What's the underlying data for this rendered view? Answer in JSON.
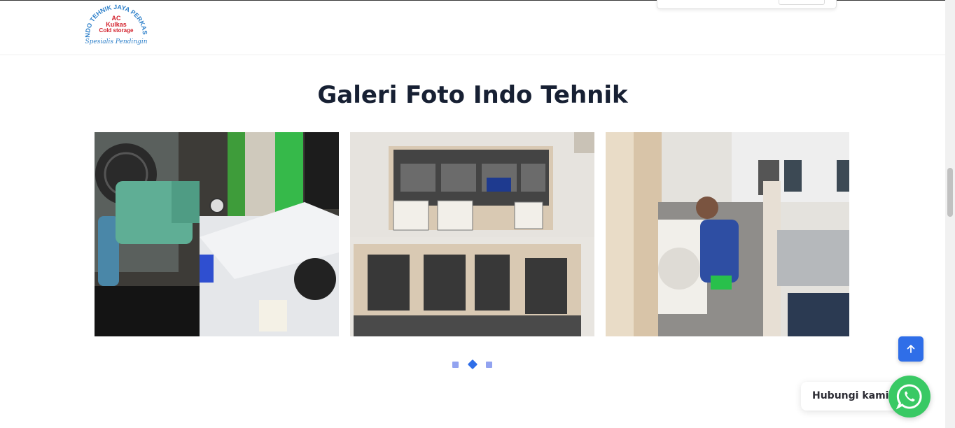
{
  "header": {
    "logo": {
      "arc_text": "INDO TEHNIK JAYA PERKASA",
      "line1": "AC",
      "line2": "Kulkas",
      "line3": "Cold storage",
      "tagline": "Spesialis Pendingin"
    }
  },
  "gallery": {
    "title": "Galeri Foto Indo Tehnik",
    "slides": [
      {
        "name": "refrigeration-compressor-unit"
      },
      {
        "name": "ac-outdoor-units-cages"
      },
      {
        "name": "technician-servicing-ac"
      }
    ],
    "active_dot": 2,
    "dot_count": 3
  },
  "floating": {
    "chat_label": "Hubungi kami",
    "chat_icon": "whatsapp-icon",
    "top_icon": "arrow-up-icon"
  },
  "colors": {
    "accent": "#2f6ee8",
    "whatsapp": "#39c964",
    "title": "#172033"
  }
}
